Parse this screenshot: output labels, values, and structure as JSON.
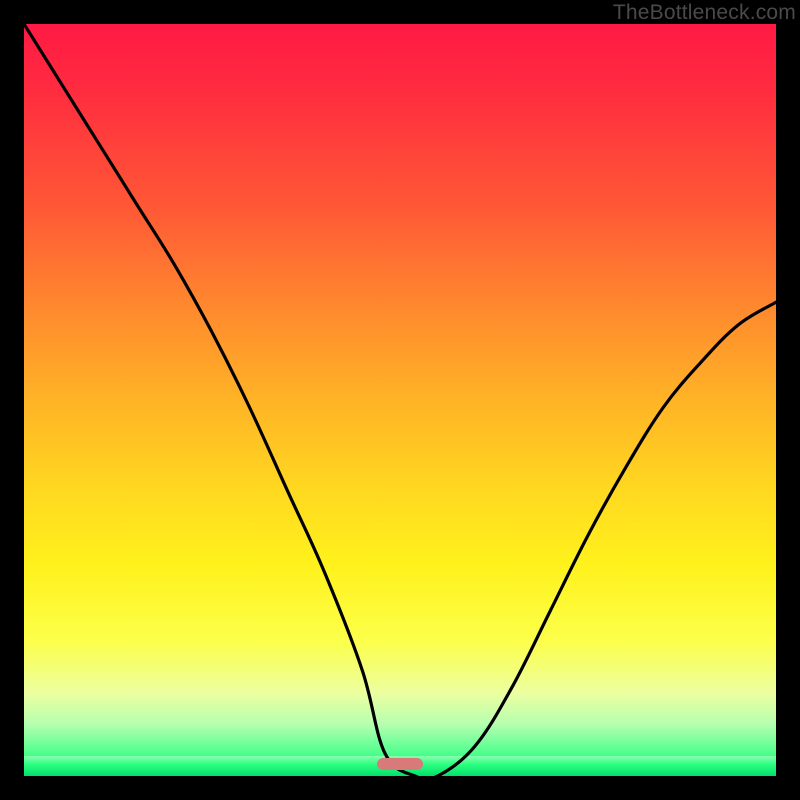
{
  "watermark": "TheBottleneck.com",
  "chart_data": {
    "type": "line",
    "title": "",
    "xlabel": "",
    "ylabel": "",
    "xlim": [
      0,
      100
    ],
    "ylim": [
      0,
      100
    ],
    "grid": false,
    "legend": false,
    "series": [
      {
        "name": "curve",
        "x": [
          0,
          5,
          10,
          15,
          20,
          25,
          30,
          35,
          40,
          45,
          48,
          52,
          55,
          60,
          65,
          70,
          75,
          80,
          85,
          90,
          95,
          100
        ],
        "y": [
          100,
          92,
          84,
          76,
          68,
          59,
          49,
          38,
          27,
          14,
          3,
          0,
          0,
          4,
          12,
          22,
          32,
          41,
          49,
          55,
          60,
          63
        ]
      }
    ],
    "marker": {
      "x_center": 50,
      "width_pct": 6,
      "y": 0
    },
    "gradient_stops": [
      {
        "pct": 0,
        "color": "#ff1a44"
      },
      {
        "pct": 25,
        "color": "#ff5a35"
      },
      {
        "pct": 50,
        "color": "#ffb326"
      },
      {
        "pct": 72,
        "color": "#fff21c"
      },
      {
        "pct": 89,
        "color": "#ecffa0"
      },
      {
        "pct": 100,
        "color": "#00e870"
      }
    ]
  }
}
